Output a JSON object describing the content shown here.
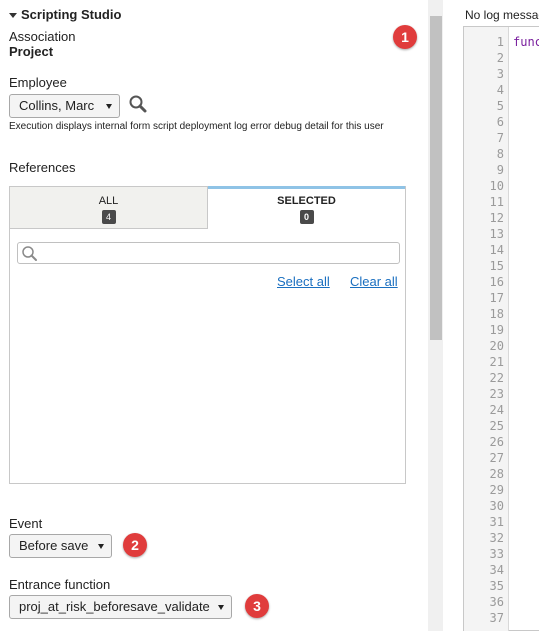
{
  "panel": {
    "title": "Scripting Studio",
    "association_label": "Association",
    "association_value": "Project",
    "employee_label": "Employee",
    "employee_value": "Collins, Marc",
    "employee_help": "Execution displays internal form script deployment log error debug detail for this user",
    "references_label": "References",
    "tabs": [
      {
        "label": "ALL",
        "count": "4"
      },
      {
        "label": "SELECTED",
        "count": "0"
      }
    ],
    "search_placeholder": "",
    "select_all": "Select all",
    "clear_all": "Clear all",
    "event_label": "Event",
    "event_value": "Before save",
    "entrance_label": "Entrance function",
    "entrance_value": "proj_at_risk_beforesave_validate"
  },
  "callouts": [
    "1",
    "2",
    "3"
  ],
  "log": {
    "message": "No log messages",
    "code_first_line": "function"
  },
  "line_numbers": [
    "1",
    "2",
    "3",
    "4",
    "5",
    "6",
    "7",
    "8",
    "9",
    "10",
    "11",
    "12",
    "13",
    "14",
    "15",
    "16",
    "17",
    "18",
    "19",
    "20",
    "21",
    "22",
    "23",
    "24",
    "25",
    "26",
    "27",
    "28",
    "29",
    "30",
    "31",
    "32",
    "33",
    "34",
    "35",
    "36",
    "37"
  ],
  "colors": {
    "callout": "#e03c3c",
    "link": "#1a6fc0",
    "selected_tab_accent": "#8fc3e6"
  }
}
